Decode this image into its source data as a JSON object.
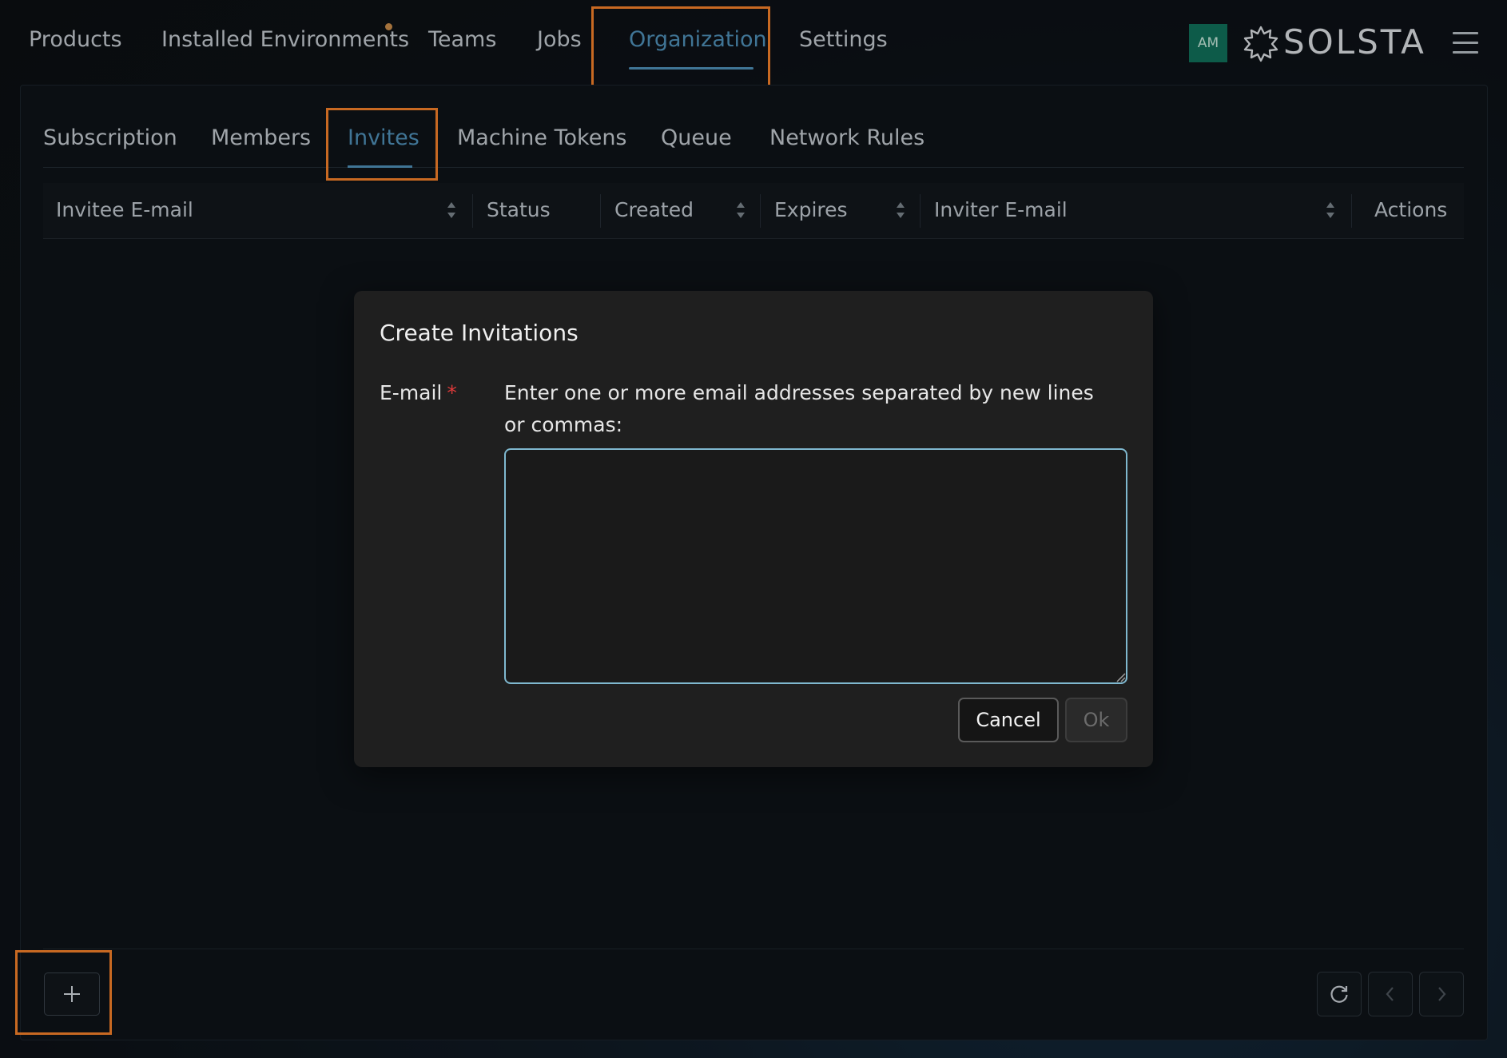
{
  "topnav": {
    "items": [
      "Products",
      "Installed Environments",
      "Teams",
      "Jobs",
      "Organization",
      "Settings"
    ],
    "active": "Organization",
    "avatar_initials": "AM",
    "brand": "SOLSTA",
    "accent_color": "#4f8fb7",
    "notification_dot_color": "#c98b4a"
  },
  "subtabs": {
    "items": [
      "Subscription",
      "Members",
      "Invites",
      "Machine Tokens",
      "Queue",
      "Network Rules"
    ],
    "active": "Invites"
  },
  "table": {
    "columns": [
      "Invitee E-mail",
      "Status",
      "Created",
      "Expires",
      "Inviter E-mail",
      "Actions"
    ],
    "rows": []
  },
  "modal": {
    "title": "Create Invitations",
    "email_label": "E-mail",
    "required_marker": "*",
    "help_text": "Enter one or more email addresses separated by new lines or commas:",
    "textarea_value": "",
    "cancel_label": "Cancel",
    "ok_label": "Ok"
  },
  "footer": {
    "add_icon": "plus-icon",
    "refresh_icon": "refresh-icon",
    "prev_icon": "chevron-left-icon",
    "next_icon": "chevron-right-icon"
  },
  "highlight_color": "#f5802a"
}
